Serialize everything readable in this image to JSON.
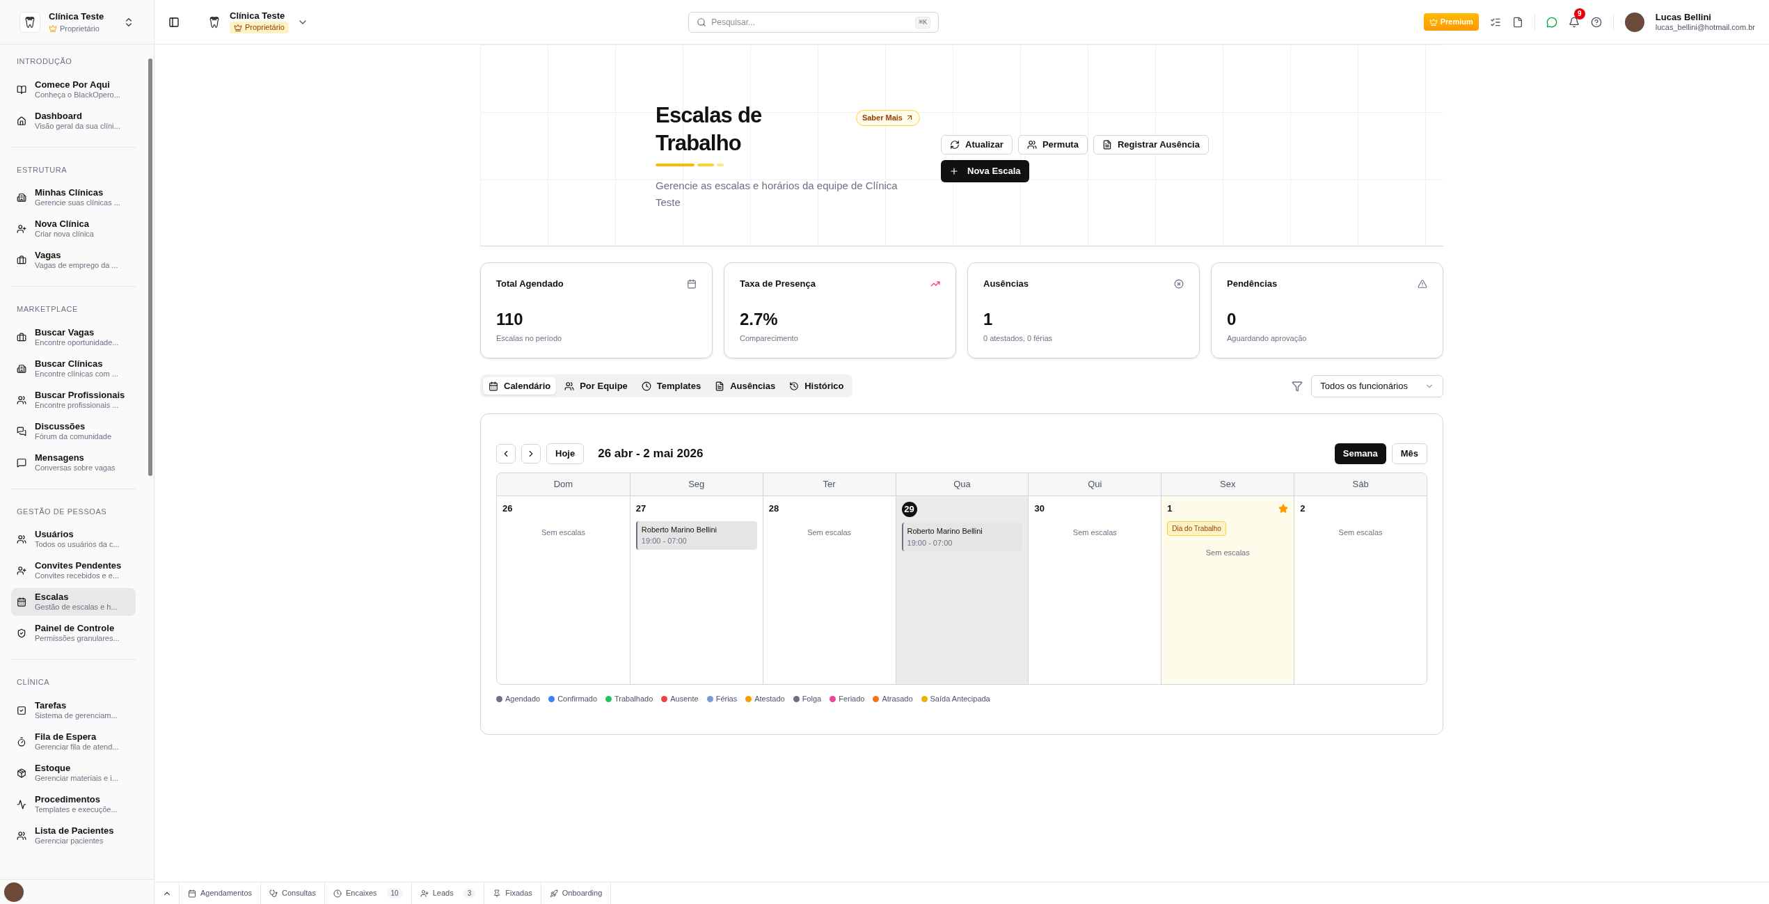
{
  "sidebar": {
    "clinic": {
      "name": "Clínica Teste",
      "role": "Proprietário"
    },
    "sections": [
      {
        "title": "INTRODUÇÃO",
        "items": [
          {
            "label": "Comece Por Aqui",
            "description": "Conheça o BlackOpero...",
            "selected": false
          },
          {
            "label": "Dashboard",
            "description": "Visão geral da sua clíni...",
            "selected": false
          }
        ]
      },
      {
        "title": "ESTRUTURA",
        "items": [
          {
            "label": "Minhas Clínicas",
            "description": "Gerencie suas clínicas ...",
            "selected": false
          },
          {
            "label": "Nova Clínica",
            "description": "Criar nova clínica",
            "selected": false
          },
          {
            "label": "Vagas",
            "description": "Vagas de emprego da ...",
            "selected": false
          }
        ]
      },
      {
        "title": "MARKETPLACE",
        "items": [
          {
            "label": "Buscar Vagas",
            "description": "Encontre oportunidade...",
            "selected": false
          },
          {
            "label": "Buscar Clínicas",
            "description": "Encontre clínicas com ...",
            "selected": false
          },
          {
            "label": "Buscar Profissionais",
            "description": "Encontre profissionais ...",
            "selected": false
          },
          {
            "label": "Discussões",
            "description": "Fórum da comunidade",
            "selected": false
          },
          {
            "label": "Mensagens",
            "description": "Conversas sobre vagas",
            "selected": false
          }
        ]
      },
      {
        "title": "GESTÃO DE PESSOAS",
        "items": [
          {
            "label": "Usuários",
            "description": "Todos os usuários da c...",
            "selected": false
          },
          {
            "label": "Convites Pendentes",
            "description": "Convites recebidos e e...",
            "selected": false
          },
          {
            "label": "Escalas",
            "description": "Gestão de escalas e h...",
            "selected": true
          },
          {
            "label": "Painel de Controle",
            "description": "Permissões granulares...",
            "selected": false
          }
        ]
      },
      {
        "title": "CLÍNICA",
        "items": [
          {
            "label": "Tarefas",
            "description": "Sistema de gerenciam...",
            "selected": false
          },
          {
            "label": "Fila de Espera",
            "description": "Gerenciar fila de atend...",
            "selected": false
          },
          {
            "label": "Estoque",
            "description": "Gerenciar materiais e i...",
            "selected": false
          },
          {
            "label": "Procedimentos",
            "description": "Templates e execuçõe...",
            "selected": false
          },
          {
            "label": "Lista de Pacientes",
            "description": "Gerenciar pacientes",
            "selected": false
          }
        ]
      }
    ]
  },
  "topbar": {
    "clinic": "Clínica Teste",
    "role": "Proprietário",
    "search": {
      "placeholder": "Pesquisar...",
      "shortcut": "⌘K"
    },
    "premium": "Premium",
    "notifications": "9",
    "user": {
      "name": "Lucas Bellini",
      "email": "lucas_bellini@hotmail.com.br"
    }
  },
  "header": {
    "title": "Escalas de Trabalho",
    "learn_more": "Saber Mais",
    "subtitle": "Gerencie as escalas e horários da equipe de Clínica Teste",
    "actions": [
      "Atualizar",
      "Permuta",
      "Registrar Ausência"
    ],
    "primary_action": "Nova Escala"
  },
  "stats": [
    {
      "title": "Total Agendado",
      "value": "110",
      "caption": "Escalas no período"
    },
    {
      "title": "Taxa de Presença",
      "value": "2.7%",
      "caption": "Comparecimento"
    },
    {
      "title": "Ausências",
      "value": "1",
      "caption": "0 atestados, 0 férias"
    },
    {
      "title": "Pendências",
      "value": "0",
      "caption": "Aguardando aprovação"
    }
  ],
  "tabs": [
    {
      "label": "Calendário",
      "selected": true
    },
    {
      "label": "Por Equipe",
      "selected": false
    },
    {
      "label": "Templates",
      "selected": false
    },
    {
      "label": "Ausências",
      "selected": false
    },
    {
      "label": "Histórico",
      "selected": false
    }
  ],
  "employee_filter": "Todos os funcionários",
  "calendar": {
    "today_button": "Hoje",
    "range": "26 abr - 2 mai 2026",
    "views": [
      {
        "label": "Semana",
        "selected": true
      },
      {
        "label": "Mês",
        "selected": false
      }
    ],
    "days": [
      {
        "weekday": "Dom",
        "day": "26",
        "today": false,
        "empty": "Sem escalas"
      },
      {
        "weekday": "Seg",
        "day": "27",
        "today": false,
        "shifts": [
          {
            "name": "Roberto Marino Bellini",
            "time": "19:00 - 07:00"
          }
        ]
      },
      {
        "weekday": "Ter",
        "day": "28",
        "today": false,
        "empty": "Sem escalas"
      },
      {
        "weekday": "Qua",
        "day": "29",
        "today": true,
        "shifts": [
          {
            "name": "Roberto Marino Bellini",
            "time": "19:00 - 07:00"
          }
        ]
      },
      {
        "weekday": "Qui",
        "day": "30",
        "today": false,
        "empty": "Sem escalas"
      },
      {
        "weekday": "Sex",
        "day": "1",
        "today": false,
        "holiday": "Dia do Trabalho",
        "empty": "Sem escalas"
      },
      {
        "weekday": "Sáb",
        "day": "2",
        "today": false,
        "empty": "Sem escalas"
      }
    ]
  },
  "legend": [
    {
      "label": "Agendado",
      "color": "#6b7280"
    },
    {
      "label": "Confirmado",
      "color": "#3b82f6"
    },
    {
      "label": "Trabalhado",
      "color": "#22c55e"
    },
    {
      "label": "Ausente",
      "color": "#ef4444"
    },
    {
      "label": "Férias",
      "color": "#7c9ad6"
    },
    {
      "label": "Atestado",
      "color": "#f59e0b"
    },
    {
      "label": "Folga",
      "color": "#6b7280"
    },
    {
      "label": "Feriado",
      "color": "#ec4899"
    },
    {
      "label": "Atrasado",
      "color": "#f97316"
    },
    {
      "label": "Saída Antecipada",
      "color": "#eab308"
    }
  ],
  "bottom_bar": [
    {
      "label": "Agendamentos"
    },
    {
      "label": "Consultas"
    },
    {
      "label": "Encaixes",
      "count": "10"
    },
    {
      "label": "Leads",
      "count": "3"
    },
    {
      "label": "Fixadas"
    },
    {
      "label": "Onboarding"
    }
  ]
}
